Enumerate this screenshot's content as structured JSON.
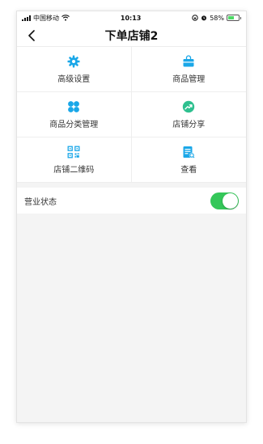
{
  "status_bar": {
    "carrier": "中国移动",
    "time": "10:13",
    "battery_percent": "58%",
    "battery_level": 0.58
  },
  "nav": {
    "title": "下单店铺2",
    "back_icon": "chevron-left-icon"
  },
  "menu": {
    "items": [
      {
        "label": "高级设置",
        "icon": "gear-icon"
      },
      {
        "label": "商品管理",
        "icon": "shopping-bag-icon"
      },
      {
        "label": "商品分类管理",
        "icon": "category-grid-icon"
      },
      {
        "label": "店铺分享",
        "icon": "share-icon"
      },
      {
        "label": "店铺二维码",
        "icon": "qrcode-icon"
      },
      {
        "label": "查看",
        "icon": "document-view-icon"
      }
    ]
  },
  "business_status": {
    "label": "营业状态",
    "enabled": true
  },
  "colors": {
    "accent": "#1aa7e8",
    "toggle_on": "#34c759",
    "background": "#f4f4f4"
  }
}
